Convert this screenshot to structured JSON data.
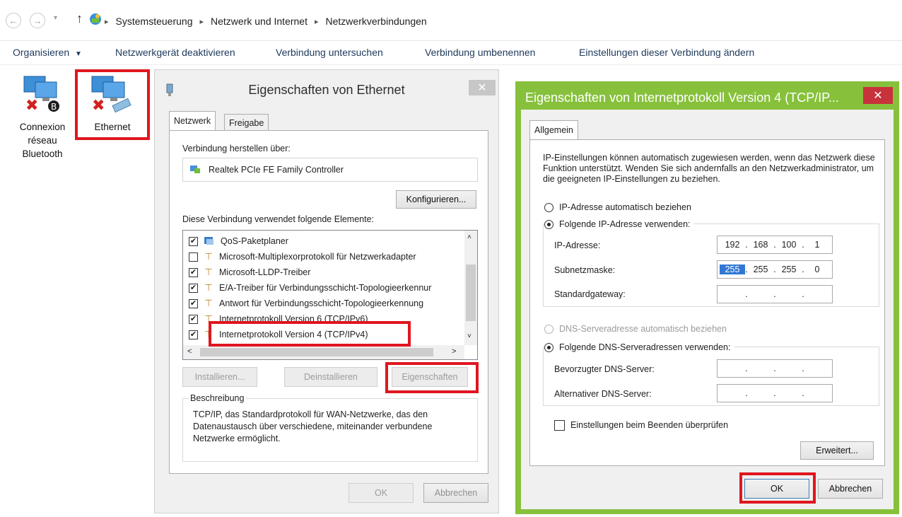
{
  "breadcrumb": [
    "Systemsteuerung",
    "Netzwerk und Internet",
    "Netzwerkverbindungen"
  ],
  "commands": {
    "organize": "Organisieren",
    "disable": "Netzwerkgerät deaktivieren",
    "diagnose": "Verbindung untersuchen",
    "rename": "Verbindung umbenennen",
    "change_settings": "Einstellungen dieser Verbindung ändern"
  },
  "connections": [
    {
      "label_lines": [
        "Connexion",
        "réseau",
        "Bluetooth"
      ]
    },
    {
      "label_lines": [
        "Ethernet"
      ]
    }
  ],
  "eth_dialog": {
    "title": "Eigenschaften von Ethernet",
    "tabs": [
      "Netzwerk",
      "Freigabe"
    ],
    "connect_using_label": "Verbindung herstellen über:",
    "adapter": "Realtek PCIe FE Family Controller",
    "configure": "Konfigurieren...",
    "elements_label": "Diese Verbindung verwendet folgende Elemente:",
    "items": [
      {
        "label": "QoS-Paketplaner",
        "checked": true
      },
      {
        "label": "Microsoft-Multiplexorprotokoll für Netzwerkadapter",
        "checked": false
      },
      {
        "label": "Microsoft-LLDP-Treiber",
        "checked": true
      },
      {
        "label": "E/A-Treiber für Verbindungsschicht-Topologieerkennur",
        "checked": true
      },
      {
        "label": "Antwort für Verbindungsschicht-Topologieerkennung",
        "checked": true
      },
      {
        "label": "Internetprotokoll Version 6 (TCP/IPv6)",
        "checked": true
      },
      {
        "label": "Internetprotokoll Version 4 (TCP/IPv4)",
        "checked": true
      }
    ],
    "install": "Installieren...",
    "uninstall": "Deinstallieren",
    "properties": "Eigenschaften",
    "description_label": "Beschreibung",
    "description": "TCP/IP, das Standardprotokoll für WAN-Netzwerke, das den Datenaustausch über verschiedene, miteinander verbundene Netzwerke ermöglicht.",
    "ok": "OK",
    "cancel": "Abbrechen"
  },
  "ipv4_dialog": {
    "title": "Eigenschaften von Internetprotokoll Version 4 (TCP/IP...",
    "tab": "Allgemein",
    "intro": "IP-Einstellungen können automatisch zugewiesen werden, wenn das Netzwerk diese Funktion unterstützt. Wenden Sie sich andernfalls an den Netzwerkadministrator, um die geeigneten IP-Einstellungen zu beziehen.",
    "ip_auto": "IP-Adresse automatisch beziehen",
    "ip_manual": "Folgende IP-Adresse verwenden:",
    "ip_label": "IP-Adresse:",
    "ip_value": [
      "192",
      "168",
      "100",
      "1"
    ],
    "mask_label": "Subnetzmaske:",
    "mask_value": [
      "255",
      "255",
      "255",
      "0"
    ],
    "gateway_label": "Standardgateway:",
    "dns_auto": "DNS-Serveradresse automatisch beziehen",
    "dns_manual": "Folgende DNS-Serveradressen verwenden:",
    "dns_pref_label": "Bevorzugter DNS-Server:",
    "dns_alt_label": "Alternativer DNS-Server:",
    "validate": "Einstellungen beim Beenden überprüfen",
    "advanced": "Erweitert...",
    "ok": "OK",
    "cancel": "Abbrechen"
  },
  "colors": {
    "highlight_red": "#e0161f",
    "dialog_green": "#87c13c",
    "close_red": "#c8323b"
  }
}
